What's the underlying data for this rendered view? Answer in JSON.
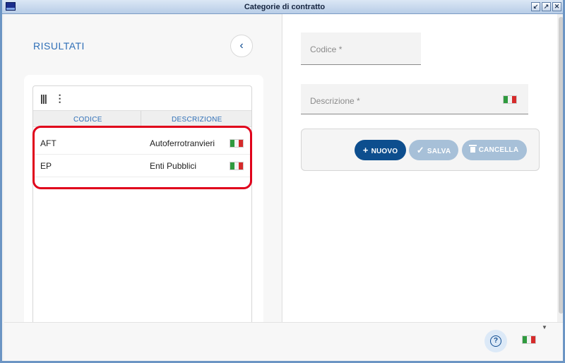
{
  "window": {
    "title": "Categorie di contratto",
    "btn_restore": "↙",
    "btn_max": "↗",
    "btn_close": "✕"
  },
  "results": {
    "title": "RISULTATI",
    "back_icon": "‹"
  },
  "grid": {
    "columns_icon": "|||",
    "more_icon": "⋮",
    "headers": [
      "CODICE",
      "DESCRIZIONE"
    ],
    "rows": [
      {
        "code": "AFT",
        "description": "Autoferrotranvieri"
      },
      {
        "code": "EP",
        "description": "Enti Pubblici"
      }
    ]
  },
  "form": {
    "code_placeholder": "Codice *",
    "description_placeholder": "Descrizione *"
  },
  "actions": {
    "new_label": "NUOVO",
    "new_icon": "+",
    "save_label": "SALVA",
    "save_icon": "✓",
    "delete_label": "CANCELLA"
  },
  "footer": {
    "help_icon": "?",
    "lang_caret": "▼"
  },
  "colors": {
    "accent": "#0d4e8e",
    "header_text": "#2f6fb7",
    "disabled_button": "#a7c0d8",
    "highlight": "#e0001b"
  }
}
